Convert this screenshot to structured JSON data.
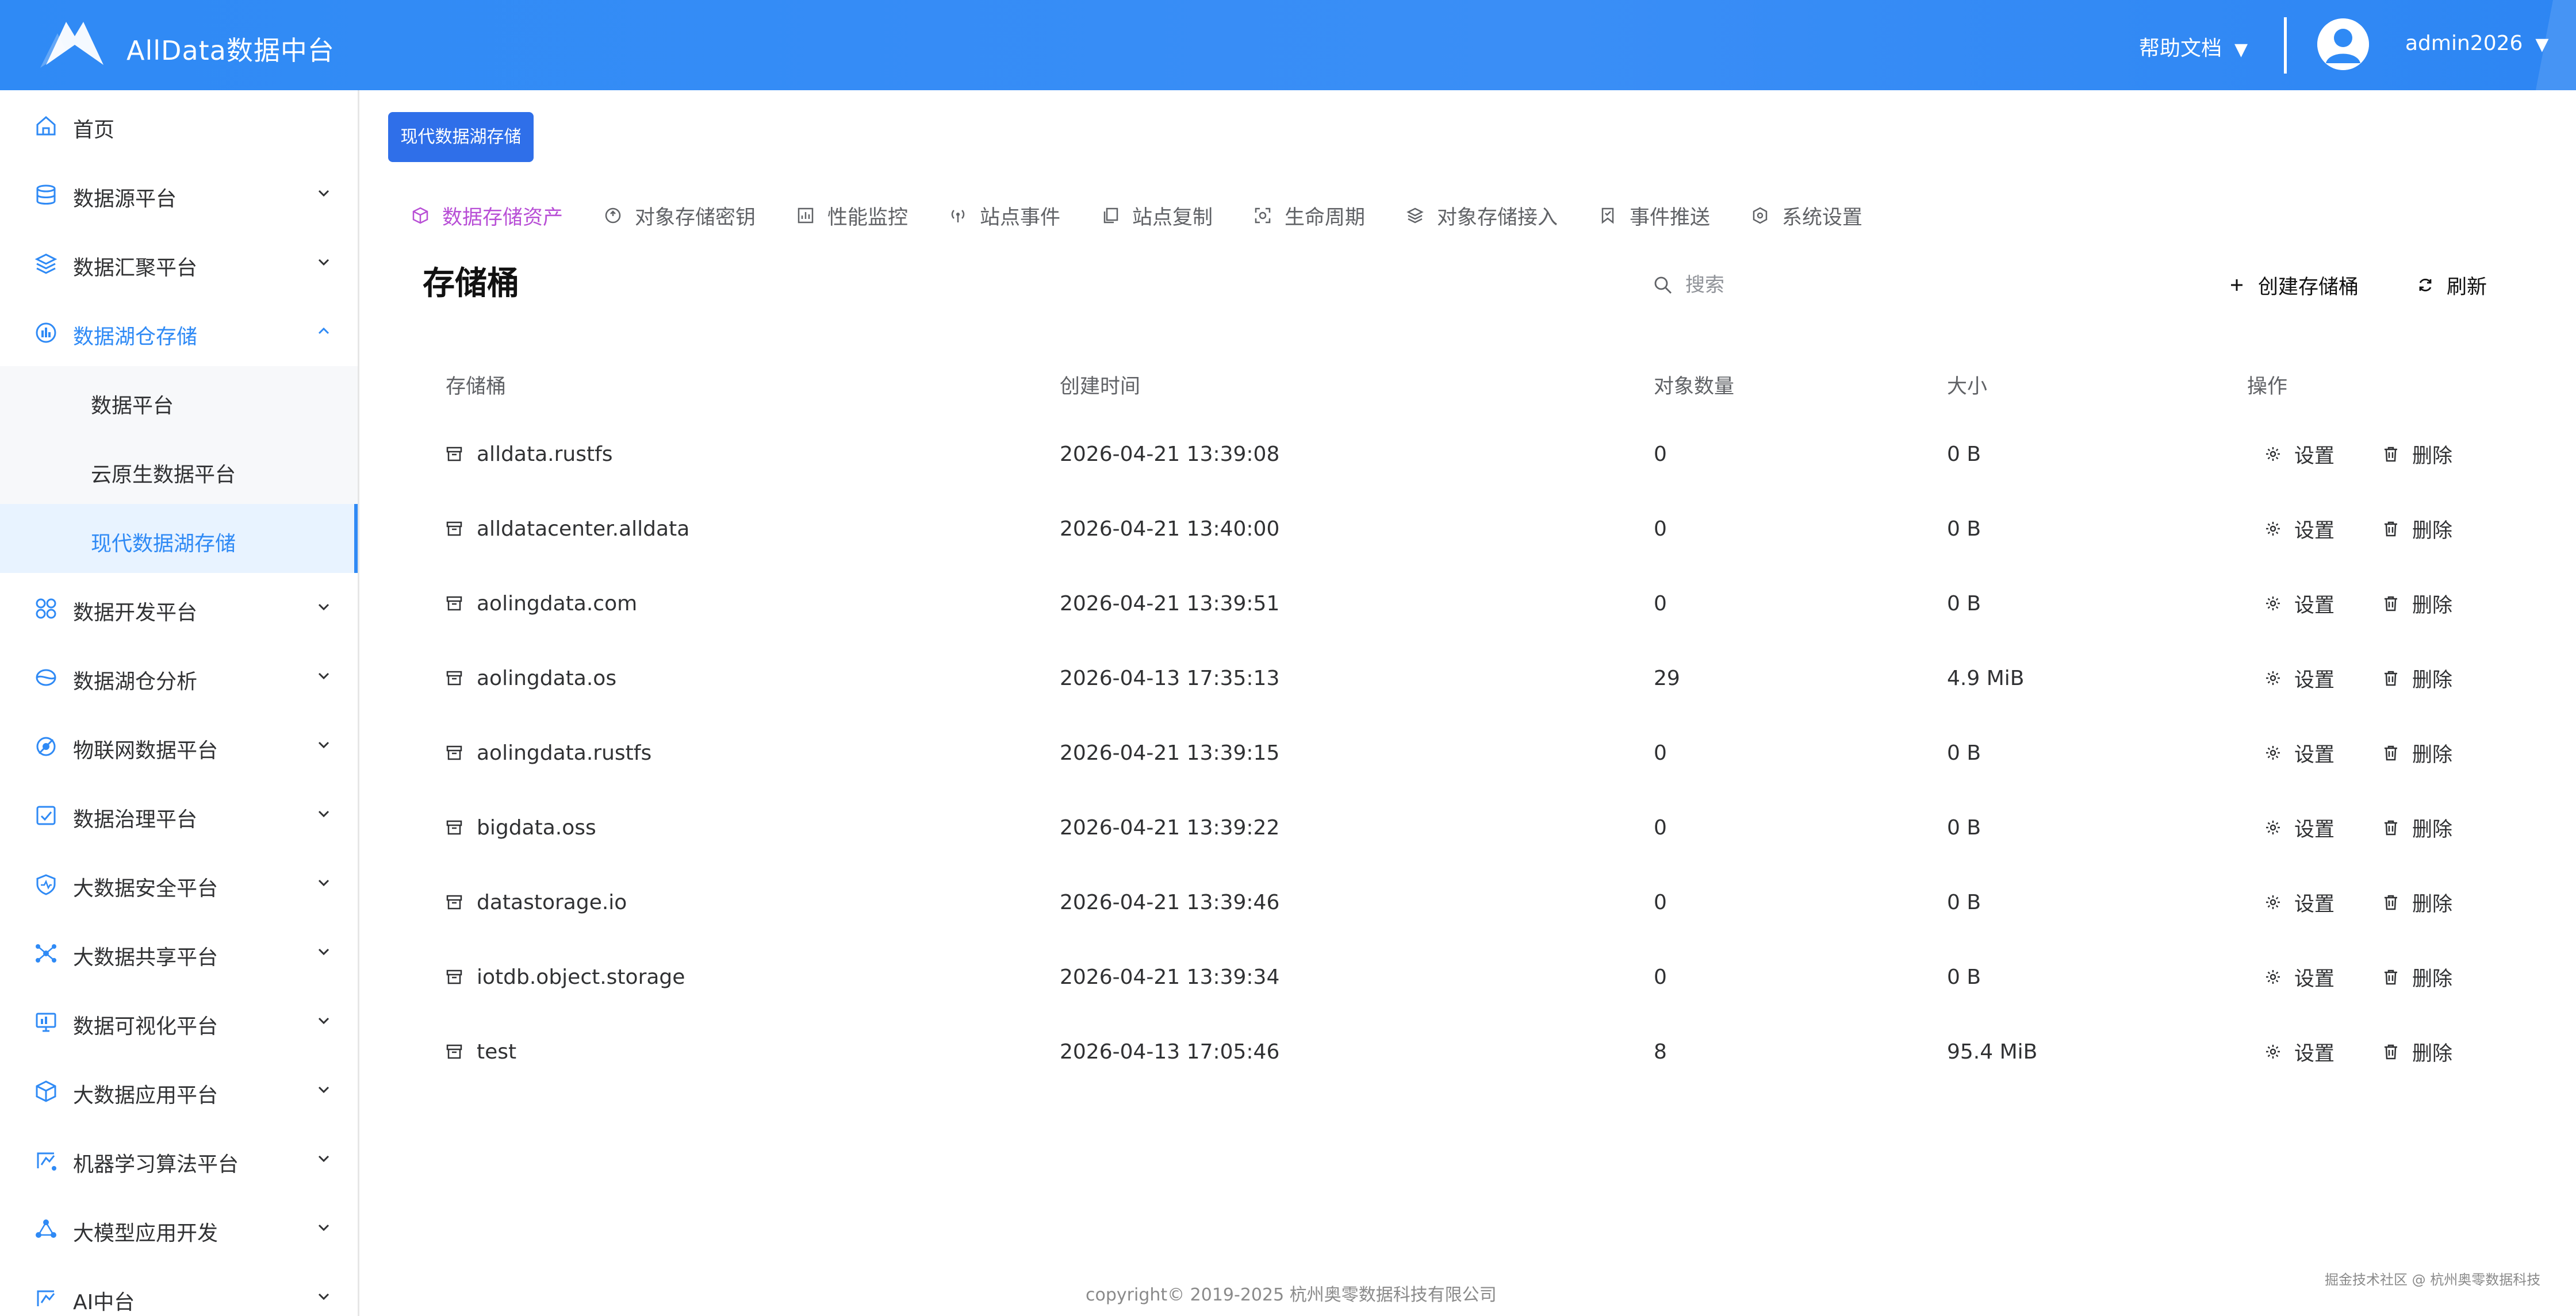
{
  "header": {
    "app_title": "AllData数据中台",
    "help_label": "帮助文档",
    "username": "admin2026",
    "caret": "▼"
  },
  "sidebar": {
    "items": [
      {
        "label": "首页",
        "icon": "home-icon"
      },
      {
        "label": "数据源平台",
        "icon": "database-icon"
      },
      {
        "label": "数据汇聚平台",
        "icon": "layers-icon"
      },
      {
        "label": "数据湖仓存储",
        "icon": "lake-icon",
        "expanded": true,
        "children": [
          {
            "label": "数据平台"
          },
          {
            "label": "云原生数据平台"
          },
          {
            "label": "现代数据湖存储",
            "active": true
          }
        ]
      },
      {
        "label": "数据开发平台",
        "icon": "grid-icon"
      },
      {
        "label": "数据湖仓分析",
        "icon": "analysis-icon"
      },
      {
        "label": "物联网数据平台",
        "icon": "iot-icon"
      },
      {
        "label": "数据治理平台",
        "icon": "governance-icon"
      },
      {
        "label": "大数据安全平台",
        "icon": "security-icon"
      },
      {
        "label": "大数据共享平台",
        "icon": "share-icon"
      },
      {
        "label": "数据可视化平台",
        "icon": "monitor-icon"
      },
      {
        "label": "大数据应用平台",
        "icon": "cube-icon"
      },
      {
        "label": "机器学习算法平台",
        "icon": "ml-icon"
      },
      {
        "label": "大模型应用开发",
        "icon": "llm-icon"
      },
      {
        "label": "AI中台",
        "icon": "ai-icon"
      }
    ]
  },
  "page_tag": "现代数据湖存储",
  "tabs": [
    {
      "label": "数据存储资产",
      "icon": "cube-icon",
      "active": true
    },
    {
      "label": "对象存储密钥",
      "icon": "key-icon"
    },
    {
      "label": "性能监控",
      "icon": "chart-icon"
    },
    {
      "label": "站点事件",
      "icon": "signal-icon"
    },
    {
      "label": "站点复制",
      "icon": "copy-icon"
    },
    {
      "label": "生命周期",
      "icon": "lifecycle-icon"
    },
    {
      "label": "对象存储接入",
      "icon": "stack-icon"
    },
    {
      "label": "事件推送",
      "icon": "bookmark-icon"
    },
    {
      "label": "系统设置",
      "icon": "settings-icon"
    }
  ],
  "page_title": "存储桶",
  "search": {
    "placeholder": "搜索",
    "value": ""
  },
  "actions": {
    "create": "创建存储桶",
    "refresh": "刷新"
  },
  "table": {
    "columns": [
      "存储桶",
      "创建时间",
      "对象数量",
      "大小",
      "操作"
    ],
    "rows": [
      {
        "name": "alldata.rustfs",
        "created": "2026-04-21 13:39:08",
        "objects": "0",
        "size": "0 B"
      },
      {
        "name": "alldatacenter.alldata",
        "created": "2026-04-21 13:40:00",
        "objects": "0",
        "size": "0 B"
      },
      {
        "name": "aolingdata.com",
        "created": "2026-04-21 13:39:51",
        "objects": "0",
        "size": "0 B"
      },
      {
        "name": "aolingdata.os",
        "created": "2026-04-13 17:35:13",
        "objects": "29",
        "size": "4.9 MiB"
      },
      {
        "name": "aolingdata.rustfs",
        "created": "2026-04-21 13:39:15",
        "objects": "0",
        "size": "0 B"
      },
      {
        "name": "bigdata.oss",
        "created": "2026-04-21 13:39:22",
        "objects": "0",
        "size": "0 B"
      },
      {
        "name": "datastorage.io",
        "created": "2026-04-21 13:39:46",
        "objects": "0",
        "size": "0 B"
      },
      {
        "name": "iotdb.object.storage",
        "created": "2026-04-21 13:39:34",
        "objects": "0",
        "size": "0 B"
      },
      {
        "name": "test",
        "created": "2026-04-13 17:05:46",
        "objects": "8",
        "size": "95.4 MiB"
      }
    ],
    "row_actions": {
      "settings": "设置",
      "delete": "删除"
    }
  },
  "footer": "copyright© 2019-2025 杭州奥零数据科技有限公司",
  "watermark": "掘金技术社区 @ 杭州奥零数据科技",
  "colors": {
    "accent": "#2f8af5",
    "active_tab": "#b84fd6",
    "header_bg": "#2f8af5",
    "tag_bg": "#2f6fe9"
  }
}
